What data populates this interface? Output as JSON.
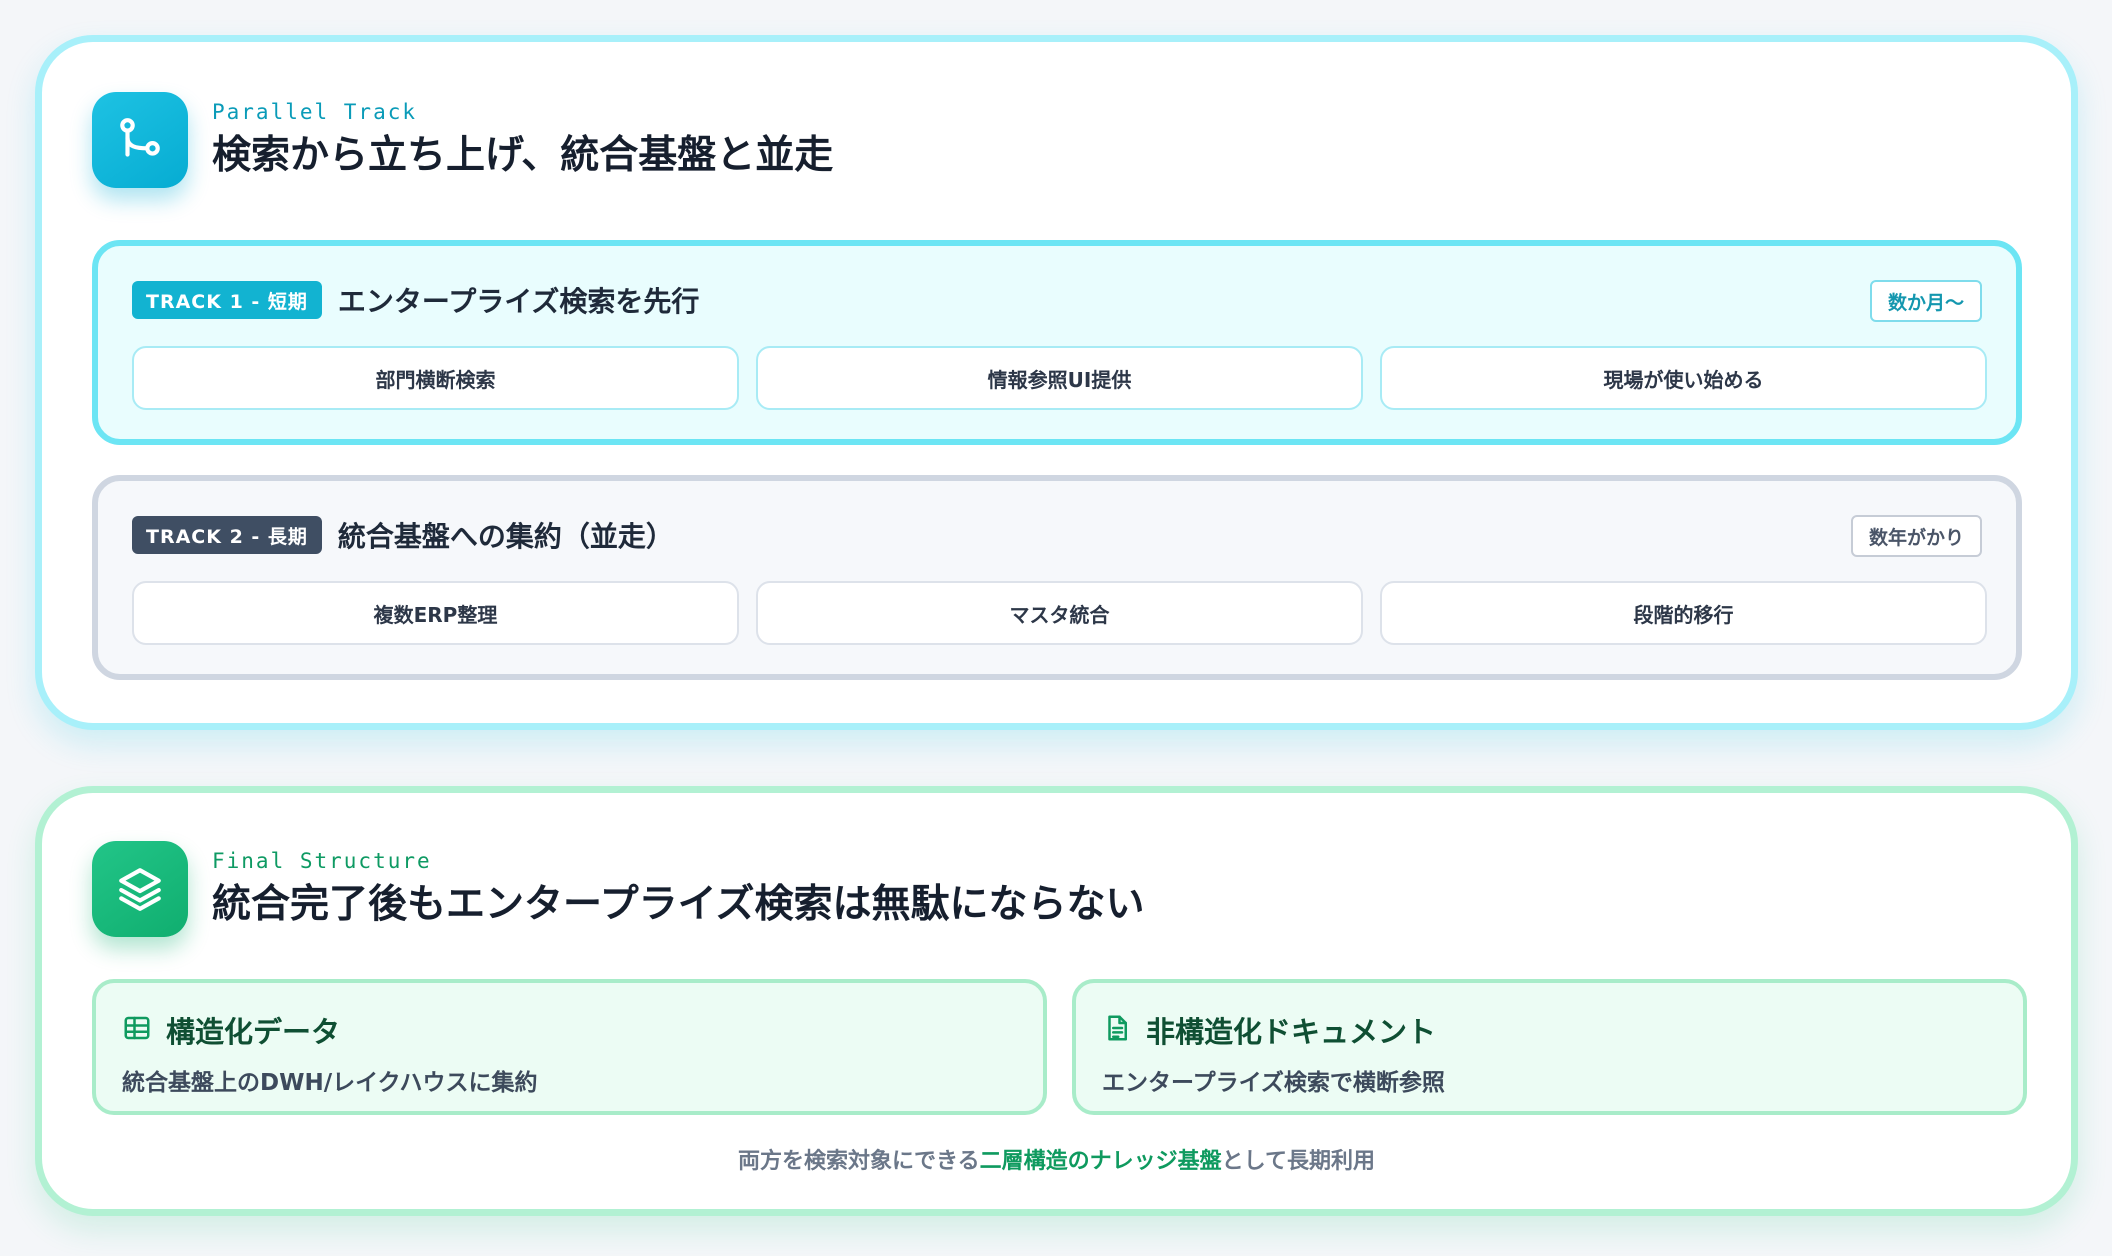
{
  "parallel": {
    "icon": "git-branch-icon",
    "eyebrow": "Parallel Track",
    "title": "検索から立ち上げ、統合基盤と並走",
    "tracks": [
      {
        "tag": "TRACK 1 - 短期",
        "title": "エンタープライズ検索を先行",
        "duration": "数か月〜",
        "steps": [
          "部門横断検索",
          "情報参照UI提供",
          "現場が使い始める"
        ]
      },
      {
        "tag": "TRACK 2 - 長期",
        "title": "統合基盤への集約（並走）",
        "duration": "数年がかり",
        "steps": [
          "複数ERP整理",
          "マスタ統合",
          "段階的移行"
        ]
      }
    ]
  },
  "final": {
    "icon": "layers-icon",
    "eyebrow": "Final Structure",
    "title": "統合完了後もエンタープライズ検索は無駄にならない",
    "layers": [
      {
        "icon": "table-icon",
        "title": "構造化データ",
        "desc": "統合基盤上のDWH/レイクハウスに集約"
      },
      {
        "icon": "document-icon",
        "title": "非構造化ドキュメント",
        "desc": "エンタープライズ検索で横断参照"
      }
    ],
    "footnote": {
      "before": "両方を検索対象にできる",
      "highlight": "二層構造のナレッジ基盤",
      "after": "として長期利用"
    }
  },
  "colors": {
    "cyan_accent": "#12b3d1",
    "green_accent": "#10ae6f",
    "slate_tag": "#3f4e63"
  }
}
